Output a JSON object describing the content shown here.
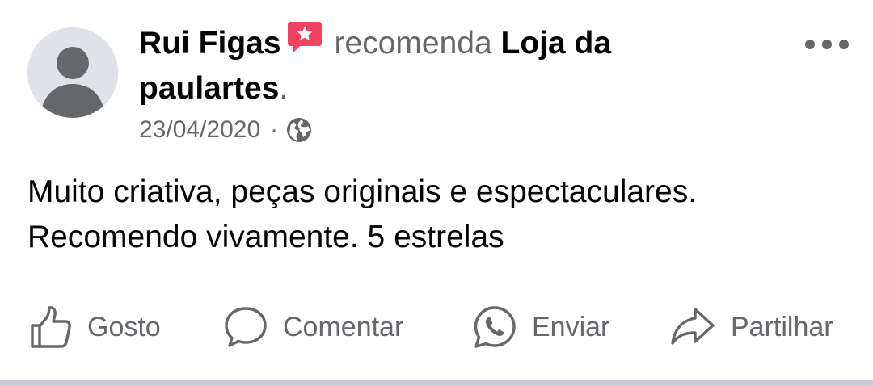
{
  "post": {
    "author": "Rui Figas",
    "verb": "recomenda",
    "page": "Loja da paulartes",
    "punctuation": ".",
    "date": "23/04/2020",
    "separator": "·",
    "privacy_icon": "globe-icon",
    "recommendation_icon": "recommendation-flag-icon",
    "body_line1": "Muito criativa, peças originais e espectaculares.",
    "body_line2": "Recomendo vivamente. 5 estrelas"
  },
  "actions": {
    "like": "Gosto",
    "comment": "Comentar",
    "send": "Enviar",
    "share": "Partilhar"
  },
  "colors": {
    "recommendation_accent": "#f3425f",
    "secondary_text": "#65676b",
    "primary_text": "#050505"
  }
}
